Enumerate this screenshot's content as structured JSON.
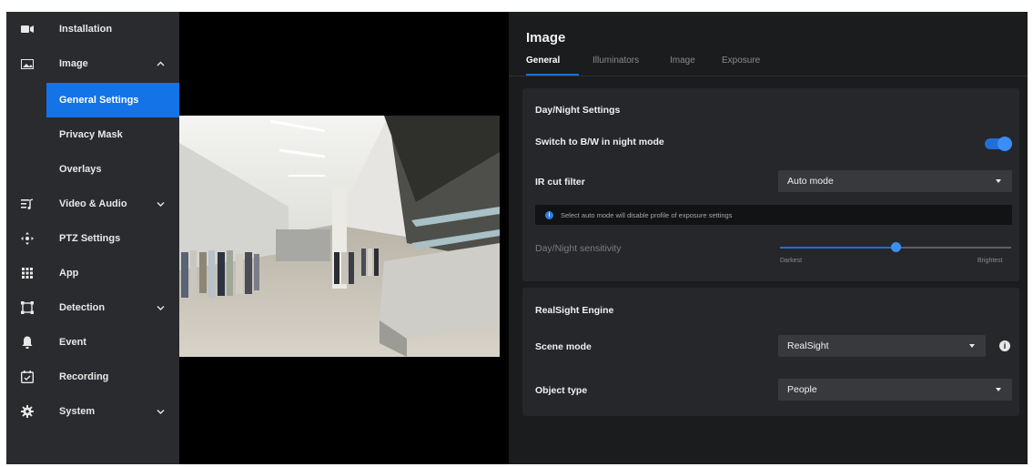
{
  "sidebar": {
    "items": [
      {
        "label": "Installation",
        "icon": "video-camera-icon"
      },
      {
        "label": "Image",
        "icon": "image-icon",
        "expanded": true
      },
      {
        "label": "Video & Audio",
        "icon": "video-audio-icon"
      },
      {
        "label": "PTZ Settings",
        "icon": "ptz-icon"
      },
      {
        "label": "App",
        "icon": "app-grid-icon"
      },
      {
        "label": "Detection",
        "icon": "detection-icon"
      },
      {
        "label": "Event",
        "icon": "bell-icon"
      },
      {
        "label": "Recording",
        "icon": "recording-icon"
      },
      {
        "label": "System",
        "icon": "gear-icon"
      }
    ],
    "sub_items": [
      {
        "label": "General Settings",
        "active": true
      },
      {
        "label": "Privacy Mask"
      },
      {
        "label": "Overlays"
      }
    ]
  },
  "panel": {
    "title": "Image",
    "tabs": [
      "General",
      "Illuminators",
      "Image",
      "Exposure"
    ],
    "active_tab": "General",
    "day_night": {
      "title": "Day/Night Settings",
      "bw_label": "Switch to B/W in night mode",
      "bw_enabled": true,
      "ir_label": "IR cut filter",
      "ir_value": "Auto mode",
      "notice": "Select auto mode will disable profile of exposure settings",
      "sensitivity_label": "Day/Night sensitivity",
      "sensitivity_fraction": 0.5,
      "min_label": "Darkest",
      "max_label": "Brightest"
    },
    "realsight": {
      "title": "RealSight Engine",
      "scene_label": "Scene mode",
      "scene_value": "RealSight",
      "object_label": "Object type",
      "object_value": "People"
    }
  },
  "colors": {
    "accent": "#1473e6",
    "sidebar_bg": "#2a2b2e",
    "panel_bg": "#1b1c1e",
    "card_bg": "#26272a"
  }
}
